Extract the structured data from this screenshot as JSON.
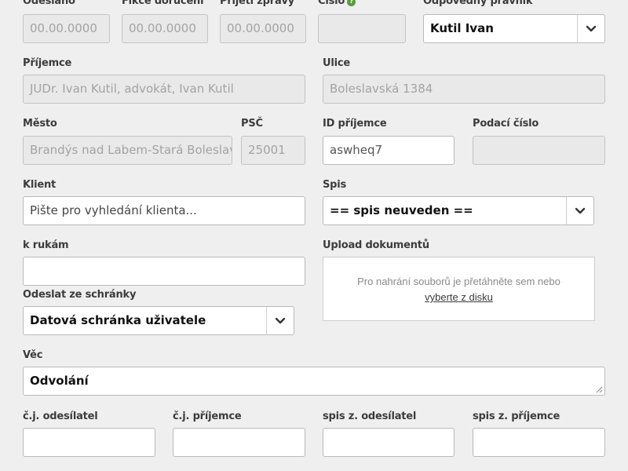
{
  "row1": {
    "odeslano": {
      "label": "Odesláno",
      "value": "00.00.0000"
    },
    "fikce": {
      "label": "Fikce doručení",
      "value": "00.00.0000"
    },
    "prijeti": {
      "label": "Přijetí zprávy",
      "value": "00.00.0000"
    },
    "cislo": {
      "label": "Číslo",
      "value": ""
    },
    "pravnik": {
      "label": "Odpovědný právník",
      "value": "Kutil Ivan"
    }
  },
  "prijemce": {
    "label": "Příjemce",
    "value": "JUDr. Ivan Kutil, advokát, Ivan Kutil"
  },
  "ulice": {
    "label": "Ulice",
    "value": "Boleslavská 1384"
  },
  "mesto": {
    "label": "Město",
    "value": "Brandýs nad Labem-Stará Boleslav"
  },
  "psc": {
    "label": "PSČ",
    "value": "25001"
  },
  "id_prijemce": {
    "label": "ID příjemce",
    "value": "aswheq7"
  },
  "podaci_cislo": {
    "label": "Podací číslo",
    "value": ""
  },
  "klient": {
    "label": "Klient",
    "placeholder": "Pište pro vyhledání klienta..."
  },
  "spis": {
    "label": "Spis",
    "value": "== spis neuveden =="
  },
  "k_rukam": {
    "label": "k rukám",
    "value": ""
  },
  "upload": {
    "label": "Upload dokumentů",
    "text": "Pro nahrání souborů je přetáhněte sem nebo",
    "link": "vyberte z disku"
  },
  "odeslat": {
    "label": "Odeslat ze schránky",
    "value": "Datová schránka uživatele"
  },
  "vec": {
    "label": "Věc",
    "value": "Odvolání"
  },
  "bottom": {
    "cj_odesilatel": {
      "label": "č.j. odesílatel",
      "value": ""
    },
    "cj_prijemce": {
      "label": "č.j. příjemce",
      "value": ""
    },
    "spis_odesilatel": {
      "label": "spis z. odesílatel",
      "value": ""
    },
    "spis_prijemce": {
      "label": "spis z. příjemce",
      "value": ""
    }
  },
  "icons": {
    "info": "info-icon",
    "dropdown": "chevron-down-icon",
    "resize": "resize-grip-icon"
  },
  "colors": {
    "background": "#efefef",
    "disabled_field": "#e9e9e9",
    "info_icon": "#5a9a3b"
  }
}
